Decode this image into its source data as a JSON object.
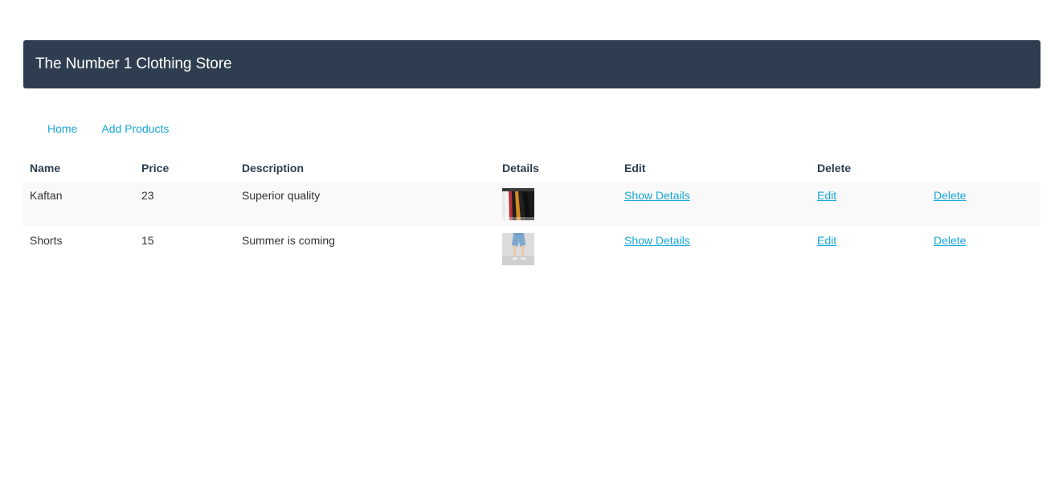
{
  "header": {
    "title": "The Number 1 Clothing Store"
  },
  "nav": {
    "items": [
      {
        "label": "Home"
      },
      {
        "label": "Add Products"
      }
    ]
  },
  "table": {
    "columns": [
      "Name",
      "Price",
      "Description",
      "Details",
      "Edit",
      "Delete"
    ],
    "rows": [
      {
        "name": "Kaftan",
        "price": "23",
        "description": "Superior quality",
        "thumbnail": "clothes-rack-image",
        "details_link": "Show Details",
        "edit_link": "Edit",
        "delete_link": "Delete"
      },
      {
        "name": "Shorts",
        "price": "15",
        "description": "Summer is coming",
        "thumbnail": "denim-shorts-image",
        "details_link": "Show Details",
        "edit_link": "Edit",
        "delete_link": "Delete"
      }
    ]
  },
  "colors": {
    "header_bg": "#2e3e50",
    "link": "#18a6d8",
    "row_stripe": "#f9f9f9"
  }
}
